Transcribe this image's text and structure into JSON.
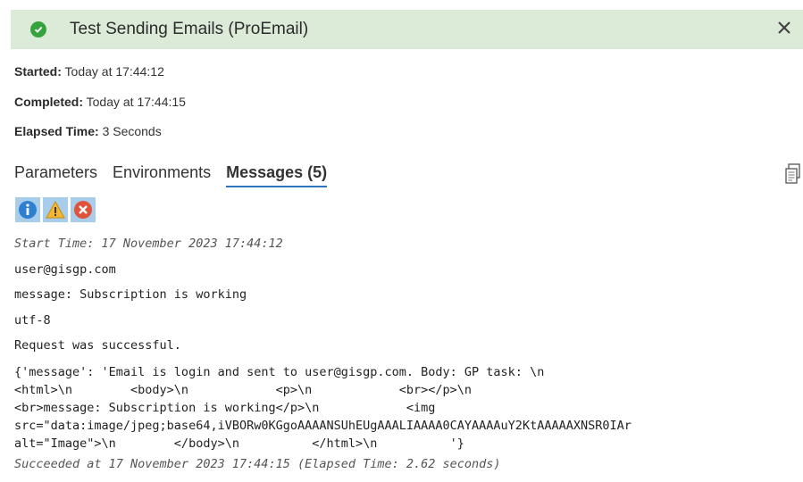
{
  "header": {
    "title": "Test Sending Emails (ProEmail)",
    "status_color": "#35a33c",
    "bg_color": "#dcebd8"
  },
  "details": {
    "started_label": "Started:",
    "started_value": "Today at 17:44:12",
    "completed_label": "Completed:",
    "completed_value": "Today at 17:44:15",
    "elapsed_label": "Elapsed Time:",
    "elapsed_value": "3 Seconds"
  },
  "tabs": [
    {
      "label": "Parameters",
      "active": false
    },
    {
      "label": "Environments",
      "active": false
    },
    {
      "label": "Messages (5)",
      "active": true
    }
  ],
  "filters": [
    "info-icon",
    "warning-icon",
    "error-icon"
  ],
  "messages": {
    "start": "Start Time: 17 November 2023 17:44:12",
    "m1": "user@gisgp.com",
    "m2": "message: Subscription is working",
    "m3": "utf-8",
    "m4": "Request was successful.",
    "m5_lines": [
      "{'message': 'Email is login and sent to user@gisgp.com. Body: GP task: \\n",
      "<html>\\n        <body>\\n            <p>\\n            <br></p>\\n",
      "<br>message: Subscription is working</p>\\n            <img",
      "src=\"data:image/jpeg;base64,iVBORw0KGgoAAAANSUhEUgAAALIAAAA0CAYAAAAuY2KtAAAAAXNSR0IAr",
      "alt=\"Image\">\\n        </body>\\n          </html>\\n          '}"
    ],
    "end": "Succeeded at 17 November 2023 17:44:15 (Elapsed Time: 2.62 seconds)"
  }
}
